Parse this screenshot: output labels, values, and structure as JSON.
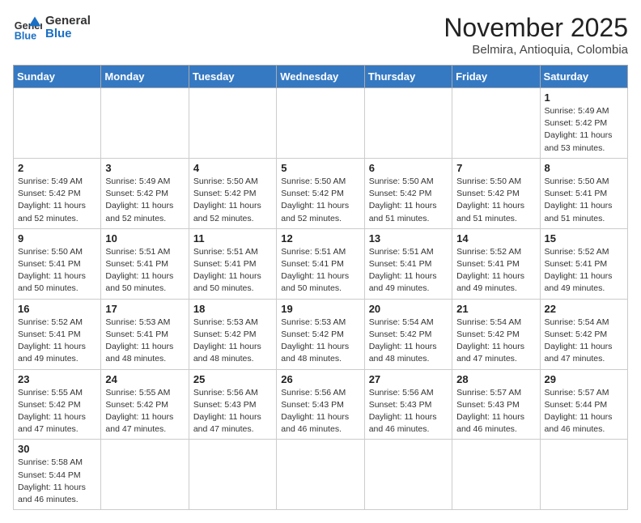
{
  "logo": {
    "text_general": "General",
    "text_blue": "Blue"
  },
  "header": {
    "month_year": "November 2025",
    "location": "Belmira, Antioquia, Colombia"
  },
  "weekdays": [
    "Sunday",
    "Monday",
    "Tuesday",
    "Wednesday",
    "Thursday",
    "Friday",
    "Saturday"
  ],
  "weeks": [
    [
      {
        "day": "",
        "info": ""
      },
      {
        "day": "",
        "info": ""
      },
      {
        "day": "",
        "info": ""
      },
      {
        "day": "",
        "info": ""
      },
      {
        "day": "",
        "info": ""
      },
      {
        "day": "",
        "info": ""
      },
      {
        "day": "1",
        "info": "Sunrise: 5:49 AM\nSunset: 5:42 PM\nDaylight: 11 hours and 53 minutes."
      }
    ],
    [
      {
        "day": "2",
        "info": "Sunrise: 5:49 AM\nSunset: 5:42 PM\nDaylight: 11 hours and 52 minutes."
      },
      {
        "day": "3",
        "info": "Sunrise: 5:49 AM\nSunset: 5:42 PM\nDaylight: 11 hours and 52 minutes."
      },
      {
        "day": "4",
        "info": "Sunrise: 5:50 AM\nSunset: 5:42 PM\nDaylight: 11 hours and 52 minutes."
      },
      {
        "day": "5",
        "info": "Sunrise: 5:50 AM\nSunset: 5:42 PM\nDaylight: 11 hours and 52 minutes."
      },
      {
        "day": "6",
        "info": "Sunrise: 5:50 AM\nSunset: 5:42 PM\nDaylight: 11 hours and 51 minutes."
      },
      {
        "day": "7",
        "info": "Sunrise: 5:50 AM\nSunset: 5:42 PM\nDaylight: 11 hours and 51 minutes."
      },
      {
        "day": "8",
        "info": "Sunrise: 5:50 AM\nSunset: 5:41 PM\nDaylight: 11 hours and 51 minutes."
      }
    ],
    [
      {
        "day": "9",
        "info": "Sunrise: 5:50 AM\nSunset: 5:41 PM\nDaylight: 11 hours and 50 minutes."
      },
      {
        "day": "10",
        "info": "Sunrise: 5:51 AM\nSunset: 5:41 PM\nDaylight: 11 hours and 50 minutes."
      },
      {
        "day": "11",
        "info": "Sunrise: 5:51 AM\nSunset: 5:41 PM\nDaylight: 11 hours and 50 minutes."
      },
      {
        "day": "12",
        "info": "Sunrise: 5:51 AM\nSunset: 5:41 PM\nDaylight: 11 hours and 50 minutes."
      },
      {
        "day": "13",
        "info": "Sunrise: 5:51 AM\nSunset: 5:41 PM\nDaylight: 11 hours and 49 minutes."
      },
      {
        "day": "14",
        "info": "Sunrise: 5:52 AM\nSunset: 5:41 PM\nDaylight: 11 hours and 49 minutes."
      },
      {
        "day": "15",
        "info": "Sunrise: 5:52 AM\nSunset: 5:41 PM\nDaylight: 11 hours and 49 minutes."
      }
    ],
    [
      {
        "day": "16",
        "info": "Sunrise: 5:52 AM\nSunset: 5:41 PM\nDaylight: 11 hours and 49 minutes."
      },
      {
        "day": "17",
        "info": "Sunrise: 5:53 AM\nSunset: 5:41 PM\nDaylight: 11 hours and 48 minutes."
      },
      {
        "day": "18",
        "info": "Sunrise: 5:53 AM\nSunset: 5:42 PM\nDaylight: 11 hours and 48 minutes."
      },
      {
        "day": "19",
        "info": "Sunrise: 5:53 AM\nSunset: 5:42 PM\nDaylight: 11 hours and 48 minutes."
      },
      {
        "day": "20",
        "info": "Sunrise: 5:54 AM\nSunset: 5:42 PM\nDaylight: 11 hours and 48 minutes."
      },
      {
        "day": "21",
        "info": "Sunrise: 5:54 AM\nSunset: 5:42 PM\nDaylight: 11 hours and 47 minutes."
      },
      {
        "day": "22",
        "info": "Sunrise: 5:54 AM\nSunset: 5:42 PM\nDaylight: 11 hours and 47 minutes."
      }
    ],
    [
      {
        "day": "23",
        "info": "Sunrise: 5:55 AM\nSunset: 5:42 PM\nDaylight: 11 hours and 47 minutes."
      },
      {
        "day": "24",
        "info": "Sunrise: 5:55 AM\nSunset: 5:42 PM\nDaylight: 11 hours and 47 minutes."
      },
      {
        "day": "25",
        "info": "Sunrise: 5:56 AM\nSunset: 5:43 PM\nDaylight: 11 hours and 47 minutes."
      },
      {
        "day": "26",
        "info": "Sunrise: 5:56 AM\nSunset: 5:43 PM\nDaylight: 11 hours and 46 minutes."
      },
      {
        "day": "27",
        "info": "Sunrise: 5:56 AM\nSunset: 5:43 PM\nDaylight: 11 hours and 46 minutes."
      },
      {
        "day": "28",
        "info": "Sunrise: 5:57 AM\nSunset: 5:43 PM\nDaylight: 11 hours and 46 minutes."
      },
      {
        "day": "29",
        "info": "Sunrise: 5:57 AM\nSunset: 5:44 PM\nDaylight: 11 hours and 46 minutes."
      }
    ],
    [
      {
        "day": "30",
        "info": "Sunrise: 5:58 AM\nSunset: 5:44 PM\nDaylight: 11 hours and 46 minutes."
      },
      {
        "day": "",
        "info": ""
      },
      {
        "day": "",
        "info": ""
      },
      {
        "day": "",
        "info": ""
      },
      {
        "day": "",
        "info": ""
      },
      {
        "day": "",
        "info": ""
      },
      {
        "day": "",
        "info": ""
      }
    ]
  ]
}
